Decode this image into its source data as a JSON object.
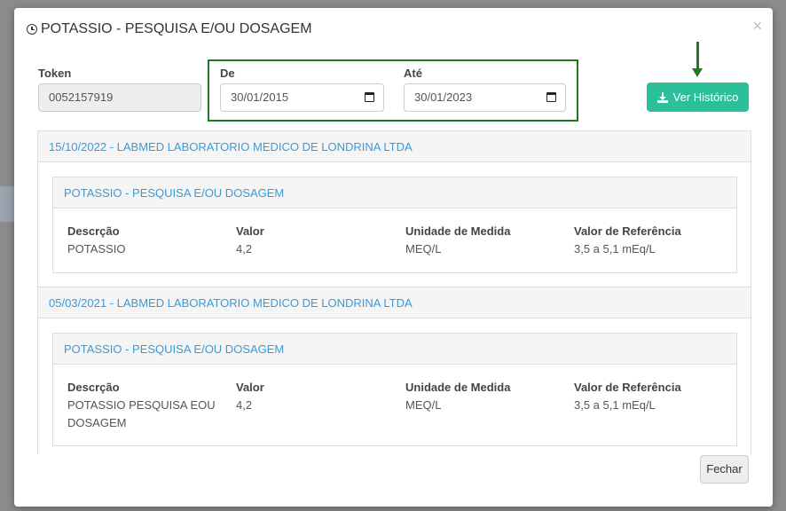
{
  "modal": {
    "title": "POTASSIO - PESQUISA E/OU DOSAGEM",
    "close_symbol": "×",
    "icon": "clock-icon"
  },
  "form": {
    "token_label": "Token",
    "token_value": "0052157919",
    "de_label": "De",
    "de_value": "30/01/2015",
    "ate_label": "Até",
    "ate_value": "30/01/2023",
    "button_label": "Ver Histórico",
    "button_icon": "download-icon"
  },
  "colors": {
    "accent_button": "#2bbf9b",
    "link_blue": "#3a9ad9",
    "highlight_green": "#1f7a1f"
  },
  "results": [
    {
      "header": "15/10/2022 - LABMED LABORATORIO MEDICO DE LONDRINA LTDA",
      "exam_title": "POTASSIO - PESQUISA E/OU DOSAGEM",
      "columns": [
        "Descrção",
        "Valor",
        "Unidade de Medida",
        "Valor de Referência"
      ],
      "values": [
        "POTASSIO",
        "4,2",
        "MEQ/L",
        "3,5 a 5,1 mEq/L"
      ]
    },
    {
      "header": "05/03/2021 - LABMED LABORATORIO MEDICO DE LONDRINA LTDA",
      "exam_title": "POTASSIO - PESQUISA E/OU DOSAGEM",
      "columns": [
        "Descrção",
        "Valor",
        "Unidade de Medida",
        "Valor de Referência"
      ],
      "values": [
        "POTASSIO PESQUISA EOU DOSAGEM",
        "4,2",
        "MEQ/L",
        "3,5 a 5,1 mEq/L"
      ]
    }
  ],
  "footer": {
    "close_label": "Fechar"
  }
}
